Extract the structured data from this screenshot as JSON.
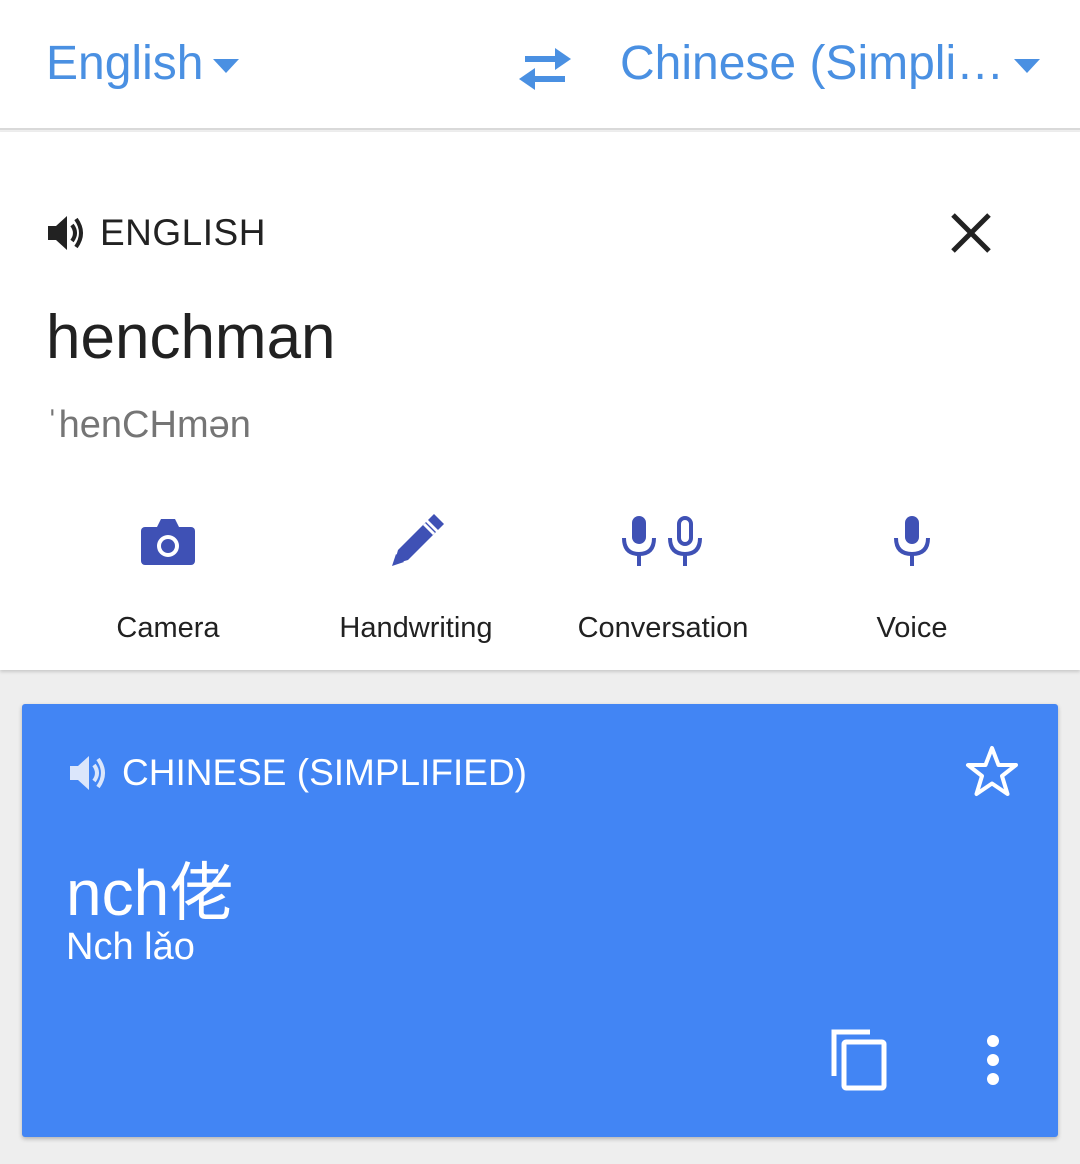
{
  "lang_bar": {
    "source_language": "English",
    "target_language": "Chinese (Simpli…"
  },
  "input_card": {
    "header_label": "ENGLISH",
    "input_text": "henchman",
    "phonetic": "ˈhenCHmən",
    "tools": [
      {
        "label": "Camera",
        "icon": "camera-icon"
      },
      {
        "label": "Handwriting",
        "icon": "pen-icon"
      },
      {
        "label": "Conversation",
        "icon": "dual-mic-icon"
      },
      {
        "label": "Voice",
        "icon": "mic-icon"
      }
    ]
  },
  "result_card": {
    "header_label": "CHINESE (SIMPLIFIED)",
    "translation": "nch佬",
    "transliteration": "Nch lǎo"
  },
  "colors": {
    "accent": "#4a90e2",
    "result_background": "#4285f4",
    "tool_icon": "#3f51b5"
  }
}
